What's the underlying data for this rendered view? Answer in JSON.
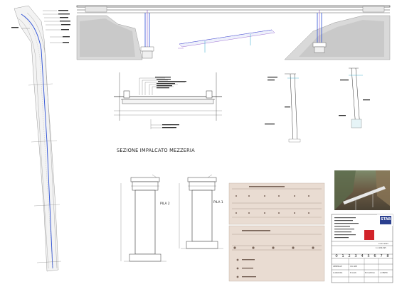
{
  "sections": {
    "deck_midspan_title": "SEZIONE IMPALCATO MEZZERIA",
    "pier_2_label": "PILA 2",
    "pier_1_label": "PILA 1"
  },
  "title_block": {
    "company": "STAB",
    "date": "15.02.2023",
    "revision_digits": [
      "0",
      "1",
      "2",
      "3",
      "4",
      "5",
      "6",
      "7",
      "8"
    ],
    "drawing_code": "1:2-180-095",
    "fields": [
      "GENERALE",
      "VIA ARB",
      "G.GRAVIDA",
      "M.LAVA",
      "B.CALDOLA",
      "L.CENTRI"
    ]
  },
  "colors": {
    "line": "#333333",
    "blue_line": "#2b4fd6",
    "purple_line": "#8a52c9",
    "cyan_line": "#26a6c9",
    "sheet_paper": "#e9dcd2",
    "terrain_fill": "#d9d9d9"
  }
}
